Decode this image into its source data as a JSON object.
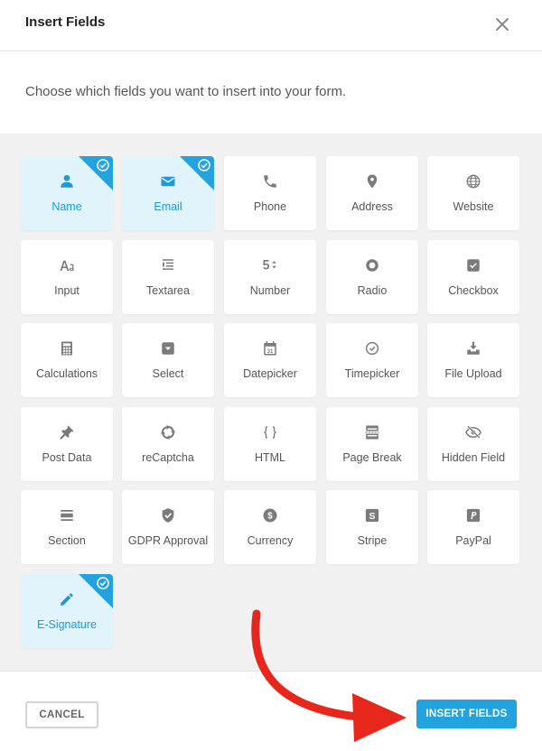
{
  "dialog": {
    "title": "Insert Fields",
    "description": "Choose which fields you want to insert into your form.",
    "close_icon": "close-icon"
  },
  "colors": {
    "accent": "#22a3df",
    "selected_bg": "#e1f3fb",
    "selected_text": "#1e9bd7",
    "annotation_arrow": "#e8271c"
  },
  "fields": [
    {
      "label": "Name",
      "icon": "user-icon",
      "selected": true
    },
    {
      "label": "Email",
      "icon": "envelope-icon",
      "selected": true
    },
    {
      "label": "Phone",
      "icon": "phone-icon",
      "selected": false
    },
    {
      "label": "Address",
      "icon": "map-pin-icon",
      "selected": false
    },
    {
      "label": "Website",
      "icon": "globe-icon",
      "selected": false
    },
    {
      "label": "Input",
      "icon": "text-format-icon",
      "selected": false
    },
    {
      "label": "Textarea",
      "icon": "text-lines-icon",
      "selected": false
    },
    {
      "label": "Number",
      "icon": "number-stepper-icon",
      "selected": false
    },
    {
      "label": "Radio",
      "icon": "radio-icon",
      "selected": false
    },
    {
      "label": "Checkbox",
      "icon": "checkbox-icon",
      "selected": false
    },
    {
      "label": "Calculations",
      "icon": "calculator-icon",
      "selected": false
    },
    {
      "label": "Select",
      "icon": "select-dropdown-icon",
      "selected": false
    },
    {
      "label": "Datepicker",
      "icon": "calendar-icon",
      "selected": false
    },
    {
      "label": "Timepicker",
      "icon": "clock-icon",
      "selected": false
    },
    {
      "label": "File Upload",
      "icon": "upload-icon",
      "selected": false
    },
    {
      "label": "Post Data",
      "icon": "pushpin-icon",
      "selected": false
    },
    {
      "label": "reCaptcha",
      "icon": "recaptcha-icon",
      "selected": false
    },
    {
      "label": "HTML",
      "icon": "code-braces-icon",
      "selected": false
    },
    {
      "label": "Page Break",
      "icon": "page-break-icon",
      "selected": false
    },
    {
      "label": "Hidden Field",
      "icon": "eye-off-icon",
      "selected": false
    },
    {
      "label": "Section",
      "icon": "section-icon",
      "selected": false
    },
    {
      "label": "GDPR Approval",
      "icon": "shield-check-icon",
      "selected": false
    },
    {
      "label": "Currency",
      "icon": "dollar-coin-icon",
      "selected": false
    },
    {
      "label": "Stripe",
      "icon": "stripe-icon",
      "selected": false
    },
    {
      "label": "PayPal",
      "icon": "paypal-icon",
      "selected": false
    },
    {
      "label": "E-Signature",
      "icon": "pencil-icon",
      "selected": true
    }
  ],
  "footer": {
    "cancel_label": "CANCEL",
    "insert_label": "INSERT FIELDS"
  }
}
